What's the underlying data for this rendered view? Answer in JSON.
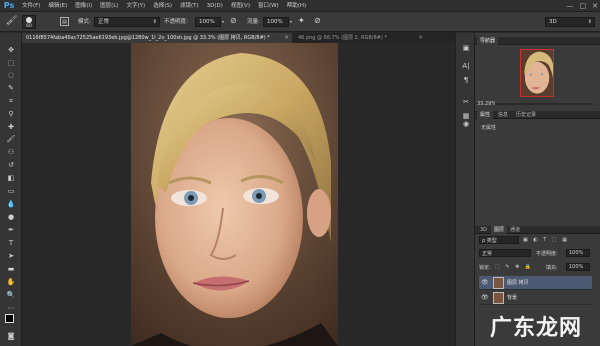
{
  "app": {
    "logo": "Ps"
  },
  "menu": [
    "文件(F)",
    "编辑(E)",
    "图像(I)",
    "图层(L)",
    "文字(Y)",
    "选择(S)",
    "滤镜(T)",
    "3D(D)",
    "视图(V)",
    "窗口(W)",
    "帮助(H)"
  ],
  "window_controls": [
    "—",
    "□",
    "✕"
  ],
  "options": {
    "brush_size": "60",
    "mode_label": "模式:",
    "mode_value": "正常",
    "opacity_label": "不透明度:",
    "opacity_value": "100%",
    "flow_label": "流量:",
    "flow_value": "100%",
    "workspace": "3D"
  },
  "tabs": [
    {
      "label": "0116f8574faba46ac72525ae6193eb.jpg@1280w_1l_2o_100sh.jpg @ 33.3% (图层 拷贝, RGB/8#) *",
      "active": true
    },
    {
      "label": "46.png @ 66.7% (图层 2, RGB/8#) *",
      "active": false
    }
  ],
  "navigator": {
    "title": "导航器",
    "zoom": "33.29%"
  },
  "properties": {
    "tabs": [
      "属性",
      "信息",
      "历史记录"
    ],
    "content": "无属性"
  },
  "layers": {
    "tabs": [
      "3D",
      "图层",
      "通道"
    ],
    "filter": "ρ 类型",
    "blend": "正常",
    "opacity_label": "不透明度:",
    "opacity_value": "100%",
    "lock_label": "锁定:",
    "fill_label": "填充:",
    "fill_value": "100%",
    "items": [
      {
        "name": "图层 拷贝",
        "selected": true
      },
      {
        "name": "背景",
        "selected": false
      }
    ]
  },
  "watermark": "广东龙网",
  "colors": {
    "accent": "#4ea8f0",
    "selected_layer": "#4b5a72"
  }
}
